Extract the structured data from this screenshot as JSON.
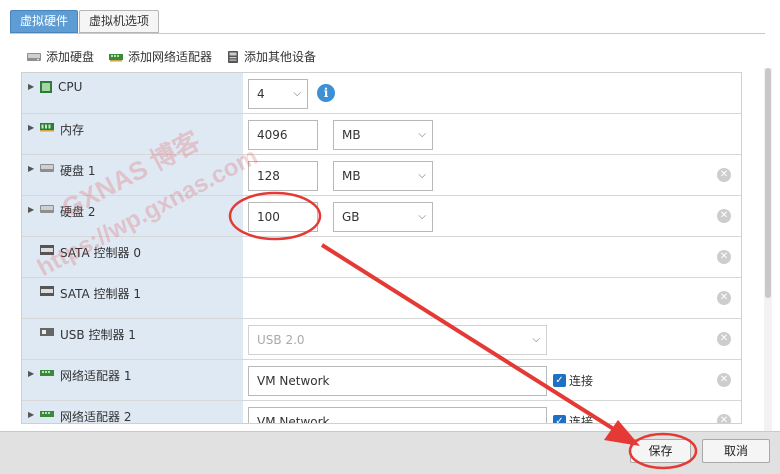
{
  "tabs": [
    {
      "label": "虚拟硬件",
      "active": true
    },
    {
      "label": "虚拟机选项",
      "active": false
    }
  ],
  "toolbar": {
    "add_disk": "添加硬盘",
    "add_nic": "添加网络适配器",
    "add_other": "添加其他设备"
  },
  "rows": {
    "cpu": {
      "label": "CPU",
      "value": "4"
    },
    "memory": {
      "label": "内存",
      "value": "4096",
      "unit": "MB"
    },
    "disk1": {
      "label": "硬盘 1",
      "value": "128",
      "unit": "MB"
    },
    "disk2": {
      "label": "硬盘 2",
      "value": "100",
      "unit": "GB"
    },
    "sata0": {
      "label": "SATA 控制器 0"
    },
    "sata1": {
      "label": "SATA 控制器 1"
    },
    "usb1": {
      "label": "USB 控制器 1",
      "value": "USB 2.0"
    },
    "nic1": {
      "label": "网络适配器 1",
      "value": "VM Network",
      "connect_label": "连接"
    },
    "nic2": {
      "label": "网络适配器 2",
      "value": "VM Network",
      "connect_label": "连接"
    }
  },
  "footer": {
    "save": "保存",
    "cancel": "取消"
  },
  "watermark": {
    "line1": "GXNAS 博客",
    "line2": "https://wp.gxnas.com"
  },
  "colors": {
    "active_tab": "#5e9dd4",
    "label_bg": "#dfe9f4",
    "annotation": "#e53935",
    "checkbox": "#1f6fc2"
  }
}
